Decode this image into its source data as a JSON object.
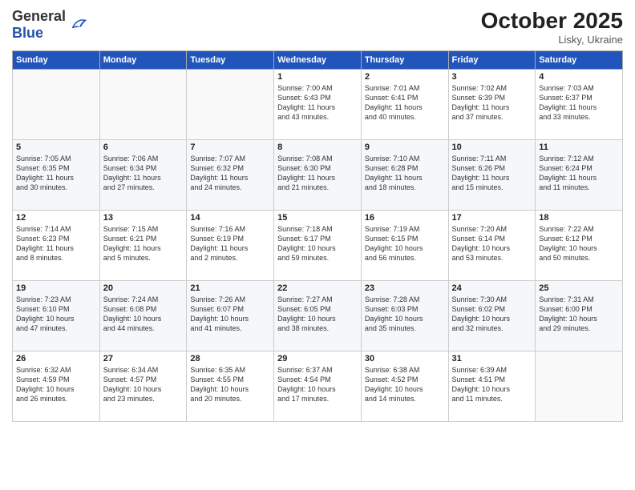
{
  "header": {
    "logo_general": "General",
    "logo_blue": "Blue",
    "month": "October 2025",
    "location": "Lisky, Ukraine"
  },
  "weekdays": [
    "Sunday",
    "Monday",
    "Tuesday",
    "Wednesday",
    "Thursday",
    "Friday",
    "Saturday"
  ],
  "weeks": [
    [
      {
        "day": "",
        "text": ""
      },
      {
        "day": "",
        "text": ""
      },
      {
        "day": "",
        "text": ""
      },
      {
        "day": "1",
        "text": "Sunrise: 7:00 AM\nSunset: 6:43 PM\nDaylight: 11 hours\nand 43 minutes."
      },
      {
        "day": "2",
        "text": "Sunrise: 7:01 AM\nSunset: 6:41 PM\nDaylight: 11 hours\nand 40 minutes."
      },
      {
        "day": "3",
        "text": "Sunrise: 7:02 AM\nSunset: 6:39 PM\nDaylight: 11 hours\nand 37 minutes."
      },
      {
        "day": "4",
        "text": "Sunrise: 7:03 AM\nSunset: 6:37 PM\nDaylight: 11 hours\nand 33 minutes."
      }
    ],
    [
      {
        "day": "5",
        "text": "Sunrise: 7:05 AM\nSunset: 6:35 PM\nDaylight: 11 hours\nand 30 minutes."
      },
      {
        "day": "6",
        "text": "Sunrise: 7:06 AM\nSunset: 6:34 PM\nDaylight: 11 hours\nand 27 minutes."
      },
      {
        "day": "7",
        "text": "Sunrise: 7:07 AM\nSunset: 6:32 PM\nDaylight: 11 hours\nand 24 minutes."
      },
      {
        "day": "8",
        "text": "Sunrise: 7:08 AM\nSunset: 6:30 PM\nDaylight: 11 hours\nand 21 minutes."
      },
      {
        "day": "9",
        "text": "Sunrise: 7:10 AM\nSunset: 6:28 PM\nDaylight: 11 hours\nand 18 minutes."
      },
      {
        "day": "10",
        "text": "Sunrise: 7:11 AM\nSunset: 6:26 PM\nDaylight: 11 hours\nand 15 minutes."
      },
      {
        "day": "11",
        "text": "Sunrise: 7:12 AM\nSunset: 6:24 PM\nDaylight: 11 hours\nand 11 minutes."
      }
    ],
    [
      {
        "day": "12",
        "text": "Sunrise: 7:14 AM\nSunset: 6:23 PM\nDaylight: 11 hours\nand 8 minutes."
      },
      {
        "day": "13",
        "text": "Sunrise: 7:15 AM\nSunset: 6:21 PM\nDaylight: 11 hours\nand 5 minutes."
      },
      {
        "day": "14",
        "text": "Sunrise: 7:16 AM\nSunset: 6:19 PM\nDaylight: 11 hours\nand 2 minutes."
      },
      {
        "day": "15",
        "text": "Sunrise: 7:18 AM\nSunset: 6:17 PM\nDaylight: 10 hours\nand 59 minutes."
      },
      {
        "day": "16",
        "text": "Sunrise: 7:19 AM\nSunset: 6:15 PM\nDaylight: 10 hours\nand 56 minutes."
      },
      {
        "day": "17",
        "text": "Sunrise: 7:20 AM\nSunset: 6:14 PM\nDaylight: 10 hours\nand 53 minutes."
      },
      {
        "day": "18",
        "text": "Sunrise: 7:22 AM\nSunset: 6:12 PM\nDaylight: 10 hours\nand 50 minutes."
      }
    ],
    [
      {
        "day": "19",
        "text": "Sunrise: 7:23 AM\nSunset: 6:10 PM\nDaylight: 10 hours\nand 47 minutes."
      },
      {
        "day": "20",
        "text": "Sunrise: 7:24 AM\nSunset: 6:08 PM\nDaylight: 10 hours\nand 44 minutes."
      },
      {
        "day": "21",
        "text": "Sunrise: 7:26 AM\nSunset: 6:07 PM\nDaylight: 10 hours\nand 41 minutes."
      },
      {
        "day": "22",
        "text": "Sunrise: 7:27 AM\nSunset: 6:05 PM\nDaylight: 10 hours\nand 38 minutes."
      },
      {
        "day": "23",
        "text": "Sunrise: 7:28 AM\nSunset: 6:03 PM\nDaylight: 10 hours\nand 35 minutes."
      },
      {
        "day": "24",
        "text": "Sunrise: 7:30 AM\nSunset: 6:02 PM\nDaylight: 10 hours\nand 32 minutes."
      },
      {
        "day": "25",
        "text": "Sunrise: 7:31 AM\nSunset: 6:00 PM\nDaylight: 10 hours\nand 29 minutes."
      }
    ],
    [
      {
        "day": "26",
        "text": "Sunrise: 6:32 AM\nSunset: 4:59 PM\nDaylight: 10 hours\nand 26 minutes."
      },
      {
        "day": "27",
        "text": "Sunrise: 6:34 AM\nSunset: 4:57 PM\nDaylight: 10 hours\nand 23 minutes."
      },
      {
        "day": "28",
        "text": "Sunrise: 6:35 AM\nSunset: 4:55 PM\nDaylight: 10 hours\nand 20 minutes."
      },
      {
        "day": "29",
        "text": "Sunrise: 6:37 AM\nSunset: 4:54 PM\nDaylight: 10 hours\nand 17 minutes."
      },
      {
        "day": "30",
        "text": "Sunrise: 6:38 AM\nSunset: 4:52 PM\nDaylight: 10 hours\nand 14 minutes."
      },
      {
        "day": "31",
        "text": "Sunrise: 6:39 AM\nSunset: 4:51 PM\nDaylight: 10 hours\nand 11 minutes."
      },
      {
        "day": "",
        "text": ""
      }
    ]
  ]
}
